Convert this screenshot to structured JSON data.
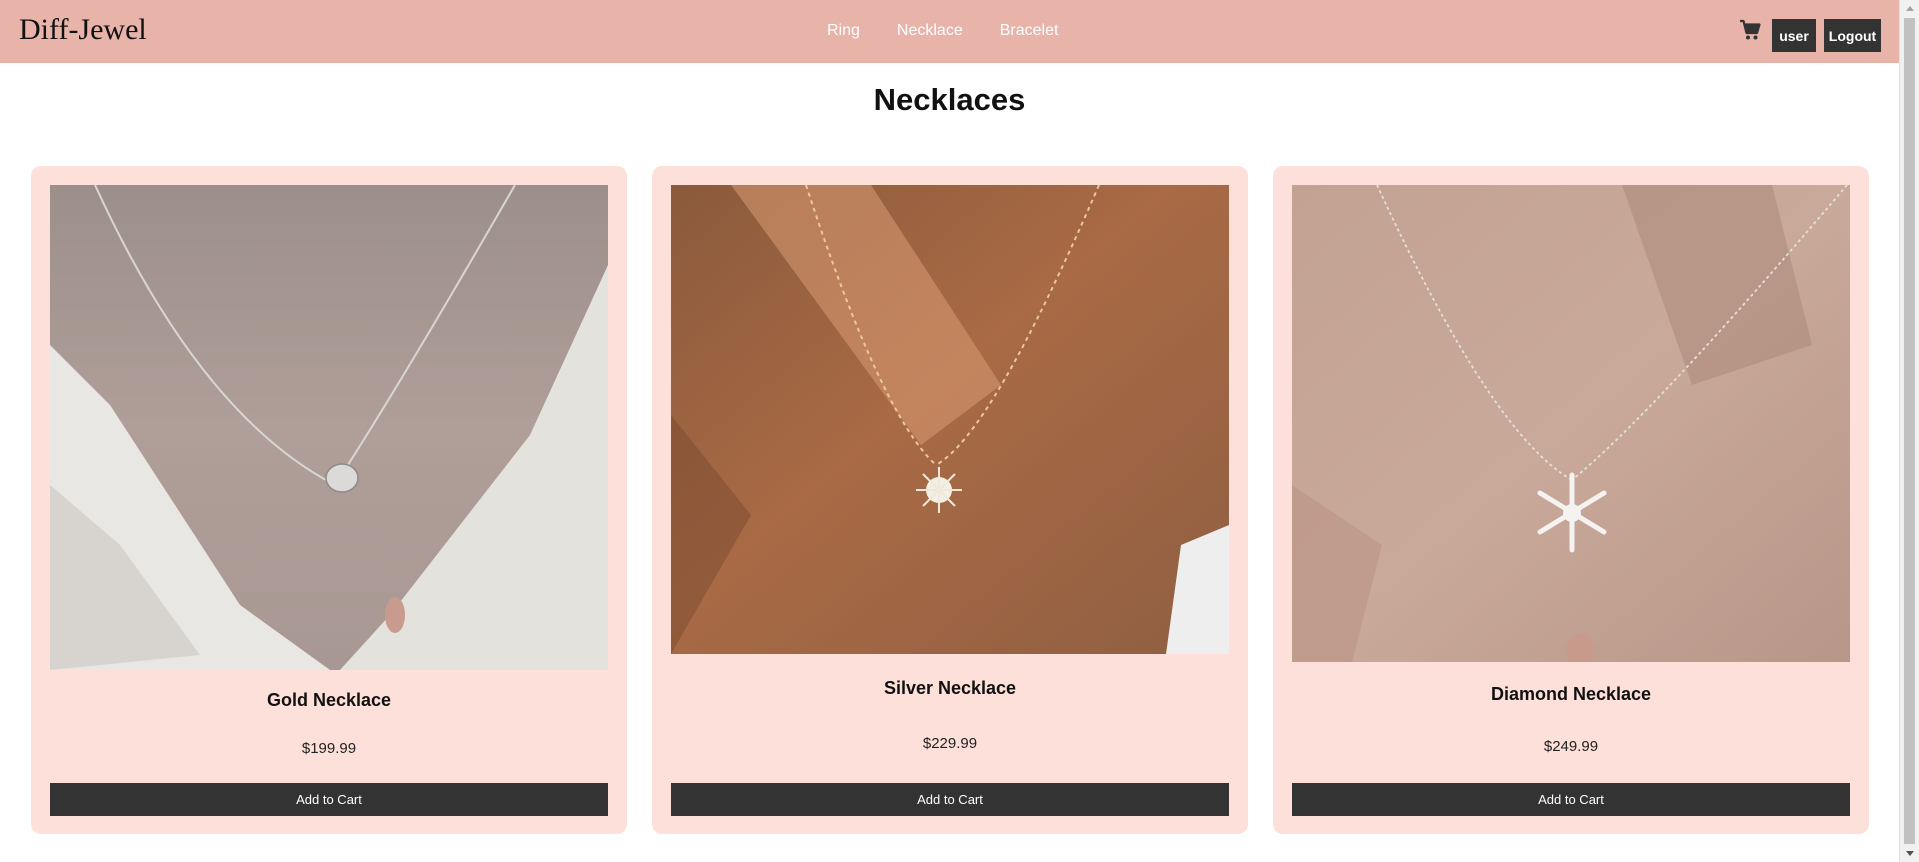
{
  "header": {
    "brand": "Diff-Jewel",
    "nav": [
      "Ring",
      "Necklace",
      "Bracelet"
    ],
    "cart_icon": "shopping-cart-icon",
    "user_label": "user",
    "logout_label": "Logout"
  },
  "page_title": "Necklaces",
  "products": [
    {
      "name": "Gold Necklace",
      "price": "$199.99",
      "add_label": "Add to Cart"
    },
    {
      "name": "Silver Necklace",
      "price": "$229.99",
      "add_label": "Add to Cart"
    },
    {
      "name": "Diamond Necklace",
      "price": "$249.99",
      "add_label": "Add to Cart"
    }
  ],
  "colors": {
    "header_bg": "#e8b3a8",
    "card_bg": "#fde0da",
    "button_bg": "#333333",
    "nav_text": "#ffffff"
  }
}
